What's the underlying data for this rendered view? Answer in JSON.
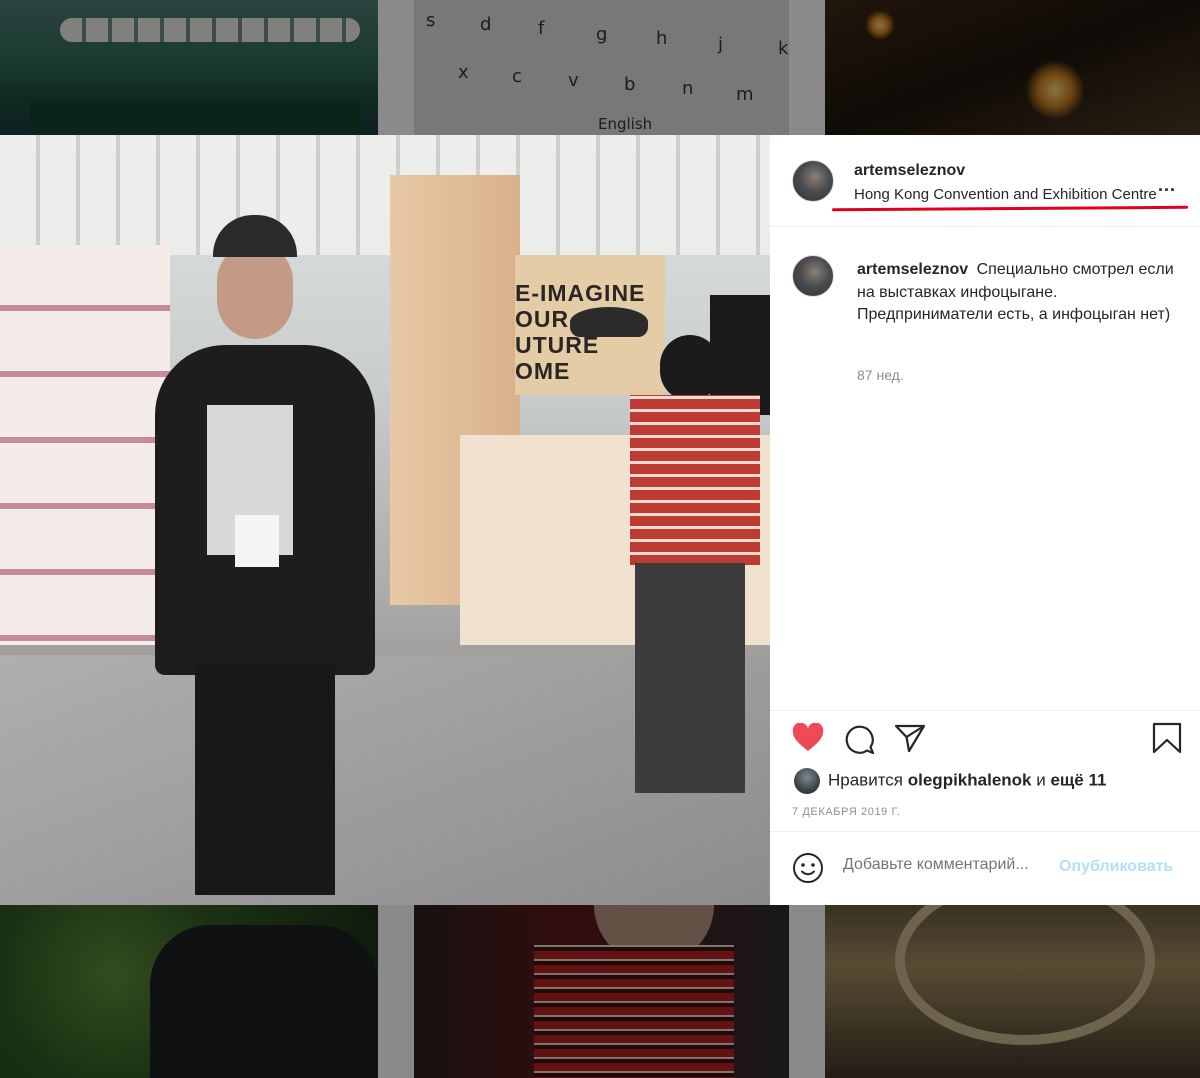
{
  "background_tiles": {
    "keyboard_keys": [
      "s",
      "d",
      "f",
      "g",
      "h",
      "j",
      "k",
      "x",
      "c",
      "v",
      "b",
      "n",
      "m"
    ],
    "keyboard_language": "English",
    "photo_sign_text": [
      "E-IMAGINE",
      "OUR",
      "UTURE",
      "OME"
    ]
  },
  "post": {
    "author": "artemseleznov",
    "location": "Hong Kong Convention and Exhibition Centre",
    "more_label": "...",
    "caption_author": "artemseleznov",
    "caption_text": "Специально смотрел если на выставках инфоцыгане. Предприниматели есть, а инфоцыган нет)",
    "caption_time": "87 нед.",
    "likes": {
      "prefix": "Нравится",
      "user": "olegpikhalenok",
      "joiner": "и",
      "rest": "ещё 11"
    },
    "date": "7 ДЕКАБРЯ 2019 Г.",
    "comment_placeholder": "Добавьте комментарий...",
    "publish_label": "Опубликовать"
  },
  "colors": {
    "like_red": "#ed4956",
    "annotation_red": "#e3001b",
    "publish_blue": "#b2dffc",
    "text": "#262626",
    "muted": "#8e8e8e"
  },
  "icons": [
    "heart-icon",
    "comment-icon",
    "share-icon",
    "bookmark-icon",
    "smile-icon",
    "more-icon"
  ]
}
